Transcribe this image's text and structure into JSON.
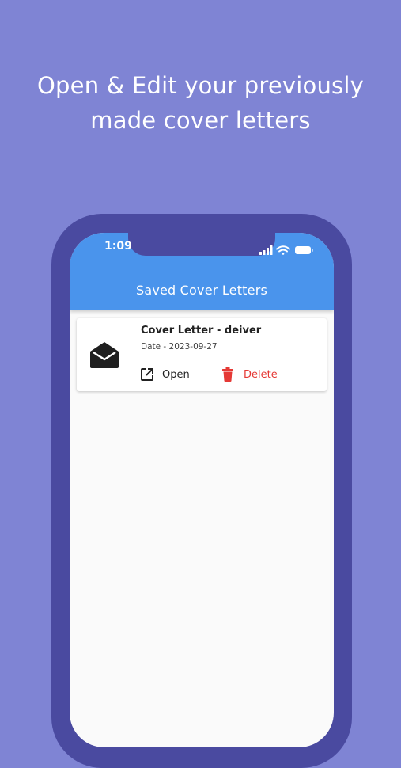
{
  "promo": {
    "headline_line1": "Open & Edit your previously",
    "headline_line2": "made cover letters"
  },
  "status_bar": {
    "time": "1:09"
  },
  "app_bar": {
    "title": "Saved Cover Letters"
  },
  "cover_letters": [
    {
      "title": "Cover Letter - deiver",
      "date": "Date - 2023-09-27",
      "icon": "envelope-open-icon",
      "open_label": "Open",
      "open_icon": "open-in-new-icon",
      "delete_label": "Delete",
      "delete_icon": "trash-icon"
    }
  ],
  "colors": {
    "background": "#7f84d4",
    "phone_frame": "#4a4aa0",
    "app_bar": "#4a94ec",
    "delete": "#e53935",
    "screen": "#fafafa"
  }
}
